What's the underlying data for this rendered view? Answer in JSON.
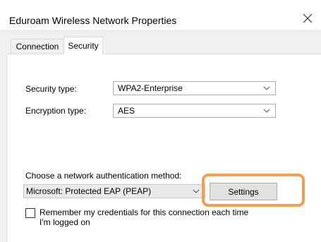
{
  "window": {
    "title": "Eduroam  Wireless Network Properties"
  },
  "tabs": [
    {
      "label": "Connection",
      "active": false
    },
    {
      "label": "Security",
      "active": true
    }
  ],
  "security": {
    "security_type_label": "Security type:",
    "security_type_value": "WPA2-Enterprise",
    "encryption_type_label": "Encryption type:",
    "encryption_type_value": "AES",
    "auth_method_label": "Choose a network authentication method:",
    "auth_method_value": "Microsoft: Protected EAP (PEAP)",
    "settings_button": "Settings",
    "remember_label": "Remember my credentials for this connection each time I'm logged on",
    "remember_checked": false
  },
  "icons": {
    "close": "close-icon",
    "dropdown": "chevron-down-icon"
  },
  "colors": {
    "highlight": "#f0a050"
  }
}
